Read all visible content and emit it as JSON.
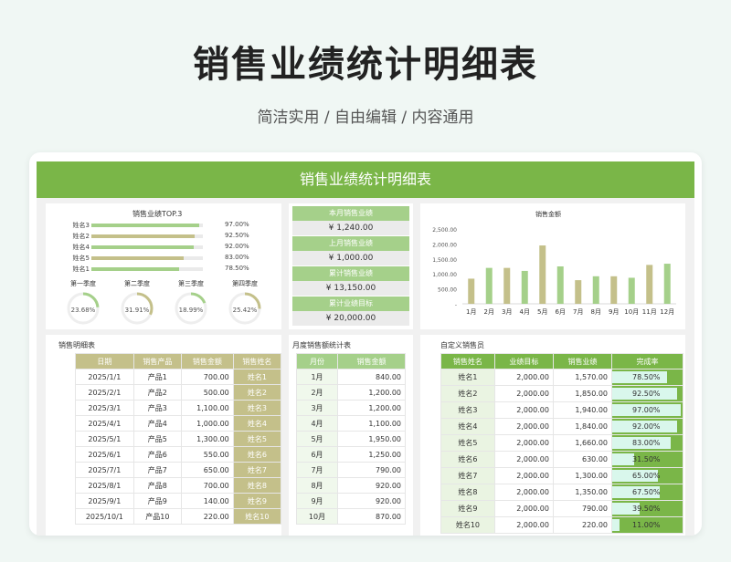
{
  "header": {
    "title": "销售业绩统计明细表",
    "subtitle": "简洁实用 / 自由编辑 / 内容通用"
  },
  "sheet": {
    "banner": "销售业绩统计明细表"
  },
  "top3": {
    "title": "销售业绩TOP.3",
    "items": [
      {
        "name": "姓名3",
        "value": "97.00%",
        "pct": 0.97,
        "color": "#a5d08a"
      },
      {
        "name": "姓名2",
        "value": "92.50%",
        "pct": 0.925,
        "color": "#c4c08a"
      },
      {
        "name": "姓名4",
        "value": "92.00%",
        "pct": 0.92,
        "color": "#a5d08a"
      },
      {
        "name": "姓名5",
        "value": "83.00%",
        "pct": 0.83,
        "color": "#c4c08a"
      },
      {
        "name": "姓名1",
        "value": "78.50%",
        "pct": 0.785,
        "color": "#a5d08a"
      }
    ]
  },
  "quarters": [
    {
      "label": "第一季度",
      "value": "23.68%",
      "pct": 0.2368,
      "color": "#a5d08a"
    },
    {
      "label": "第二季度",
      "value": "31.91%",
      "pct": 0.3191,
      "color": "#c4c08a"
    },
    {
      "label": "第三季度",
      "value": "18.99%",
      "pct": 0.1899,
      "color": "#a5d08a"
    },
    {
      "label": "第四季度",
      "value": "25.42%",
      "pct": 0.2542,
      "color": "#c4c08a"
    }
  ],
  "kpi": [
    {
      "label": "本月销售业绩",
      "value": "¥ 1,240.00"
    },
    {
      "label": "上月销售业绩",
      "value": "¥ 1,000.00"
    },
    {
      "label": "累计销售业绩",
      "value": "¥ 13,150.00"
    },
    {
      "label": "累计业绩目标",
      "value": "¥ 20,000.00"
    }
  ],
  "chart_data": {
    "type": "bar",
    "title": "销售金额",
    "categories": [
      "1月",
      "2月",
      "3月",
      "4月",
      "5月",
      "6月",
      "7月",
      "8月",
      "9月",
      "10月",
      "11月",
      "12月"
    ],
    "values": [
      840,
      1200,
      1200,
      1100,
      1950,
      1250,
      790,
      920,
      920,
      870,
      1300,
      1340
    ],
    "colors": [
      "#c4c08a",
      "#a5d08a"
    ],
    "yticks": [
      "2,500.00",
      "2,000.00",
      "1,500.00",
      "1,000.00",
      "500.00",
      "-"
    ],
    "ylim": [
      0,
      2500
    ],
    "grid": false
  },
  "sales": {
    "title": "销售明细表",
    "columns": [
      "日期",
      "销售产品",
      "销售金额",
      "销售姓名"
    ],
    "rows": [
      [
        "2025/1/1",
        "产品1",
        "700.00",
        "姓名1"
      ],
      [
        "2025/2/1",
        "产品2",
        "500.00",
        "姓名2"
      ],
      [
        "2025/3/1",
        "产品3",
        "1,100.00",
        "姓名3"
      ],
      [
        "2025/4/1",
        "产品4",
        "1,000.00",
        "姓名4"
      ],
      [
        "2025/5/1",
        "产品5",
        "1,300.00",
        "姓名5"
      ],
      [
        "2025/6/1",
        "产品6",
        "550.00",
        "姓名6"
      ],
      [
        "2025/7/1",
        "产品7",
        "650.00",
        "姓名7"
      ],
      [
        "2025/8/1",
        "产品8",
        "700.00",
        "姓名8"
      ],
      [
        "2025/9/1",
        "产品9",
        "140.00",
        "姓名9"
      ],
      [
        "2025/10/1",
        "产品10",
        "220.00",
        "姓名10"
      ]
    ]
  },
  "monthly": {
    "title": "月度销售额统计表",
    "columns": [
      "月份",
      "销售金额"
    ],
    "rows": [
      [
        "1月",
        "840.00"
      ],
      [
        "2月",
        "1,200.00"
      ],
      [
        "3月",
        "1,200.00"
      ],
      [
        "4月",
        "1,100.00"
      ],
      [
        "5月",
        "1,950.00"
      ],
      [
        "6月",
        "1,250.00"
      ],
      [
        "7月",
        "790.00"
      ],
      [
        "8月",
        "920.00"
      ],
      [
        "9月",
        "920.00"
      ],
      [
        "10月",
        "870.00"
      ]
    ]
  },
  "staff": {
    "title": "自定义销售员",
    "columns": [
      "销售姓名",
      "业绩目标",
      "销售业绩",
      "完成率"
    ],
    "rows": [
      [
        "姓名1",
        "2,000.00",
        "1,570.00",
        "78.50%",
        0.785
      ],
      [
        "姓名2",
        "2,000.00",
        "1,850.00",
        "92.50%",
        0.925
      ],
      [
        "姓名3",
        "2,000.00",
        "1,940.00",
        "97.00%",
        0.97
      ],
      [
        "姓名4",
        "2,000.00",
        "1,840.00",
        "92.00%",
        0.92
      ],
      [
        "姓名5",
        "2,000.00",
        "1,660.00",
        "83.00%",
        0.83
      ],
      [
        "姓名6",
        "2,000.00",
        "630.00",
        "31.50%",
        0.315
      ],
      [
        "姓名7",
        "2,000.00",
        "1,300.00",
        "65.00%",
        0.65
      ],
      [
        "姓名8",
        "2,000.00",
        "1,350.00",
        "67.50%",
        0.675
      ],
      [
        "姓名9",
        "2,000.00",
        "790.00",
        "39.50%",
        0.395
      ],
      [
        "姓名10",
        "2,000.00",
        "220.00",
        "11.00%",
        0.11
      ]
    ]
  }
}
